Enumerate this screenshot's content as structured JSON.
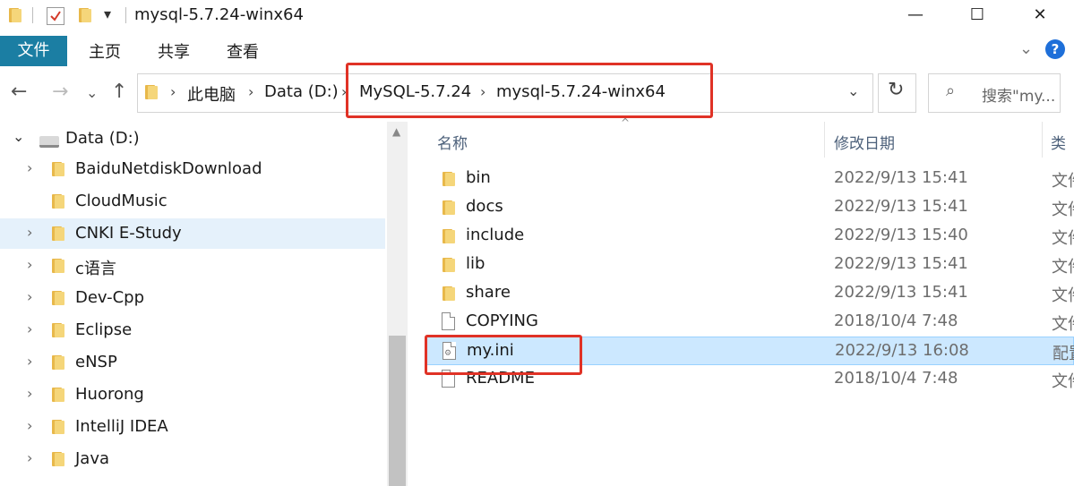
{
  "window": {
    "title": "mysql-5.7.24-winx64",
    "minimize_glyph": "—",
    "maximize_glyph": "☐",
    "close_glyph": "✕",
    "qa_dropdown_glyph": "▾"
  },
  "ribbon": {
    "file_tab": "文件",
    "tabs": [
      "主页",
      "共享",
      "查看"
    ],
    "expand_glyph": "⌄",
    "help_glyph": "?"
  },
  "nav": {
    "back_glyph": "←",
    "forward_glyph": "→",
    "recent_glyph": "⌄",
    "up_glyph": "↑",
    "breadcrumbs": [
      "此电脑",
      "Data (D:)",
      "MySQL-5.7.24",
      "mysql-5.7.24-winx64"
    ],
    "sep_glyph": "›",
    "dropdown_glyph": "⌄",
    "refresh_glyph": "↻",
    "search_glyph": "⌕",
    "search_placeholder": "搜索\"my..."
  },
  "tree": {
    "drive": {
      "label": "Data (D:)",
      "expanded_glyph": "⌄"
    },
    "collapsed_glyph": "›",
    "items": [
      {
        "label": "BaiduNetdiskDownload",
        "expandable": true
      },
      {
        "label": "CloudMusic",
        "expandable": false
      },
      {
        "label": "CNKI E-Study",
        "expandable": true,
        "selected": true
      },
      {
        "label": "c语言",
        "expandable": true
      },
      {
        "label": "Dev-Cpp",
        "expandable": true
      },
      {
        "label": "Eclipse",
        "expandable": true
      },
      {
        "label": "eNSP",
        "expandable": true
      },
      {
        "label": "Huorong",
        "expandable": true
      },
      {
        "label": "IntelliJ IDEA",
        "expandable": true
      },
      {
        "label": "Java",
        "expandable": true
      }
    ]
  },
  "list": {
    "columns": {
      "name": "名称",
      "modified": "修改日期",
      "type": "类"
    },
    "sort_glyph": "^",
    "scroll_up_glyph": "▲",
    "rows": [
      {
        "name": "bin",
        "modified": "2022/9/13 15:41",
        "type": "文件",
        "icon": "folder-icon"
      },
      {
        "name": "docs",
        "modified": "2022/9/13 15:41",
        "type": "文件",
        "icon": "folder-icon"
      },
      {
        "name": "include",
        "modified": "2022/9/13 15:40",
        "type": "文件",
        "icon": "folder-icon"
      },
      {
        "name": "lib",
        "modified": "2022/9/13 15:41",
        "type": "文件",
        "icon": "folder-icon"
      },
      {
        "name": "share",
        "modified": "2022/9/13 15:41",
        "type": "文件",
        "icon": "folder-icon"
      },
      {
        "name": "COPYING",
        "modified": "2018/10/4 7:48",
        "type": "文件",
        "icon": "file-icon"
      },
      {
        "name": "my.ini",
        "modified": "2022/9/13 16:08",
        "type": "配置",
        "icon": "settings-file-icon",
        "selected": true
      },
      {
        "name": "README",
        "modified": "2018/10/4 7:48",
        "type": "文件",
        "icon": "file-icon"
      }
    ]
  },
  "colors": {
    "file_tab": "#1b7ea3",
    "selection": "#cce8ff",
    "tree_selection": "#e5f1fb",
    "annotation_red": "#e03226",
    "folder": "#f5d67a"
  }
}
